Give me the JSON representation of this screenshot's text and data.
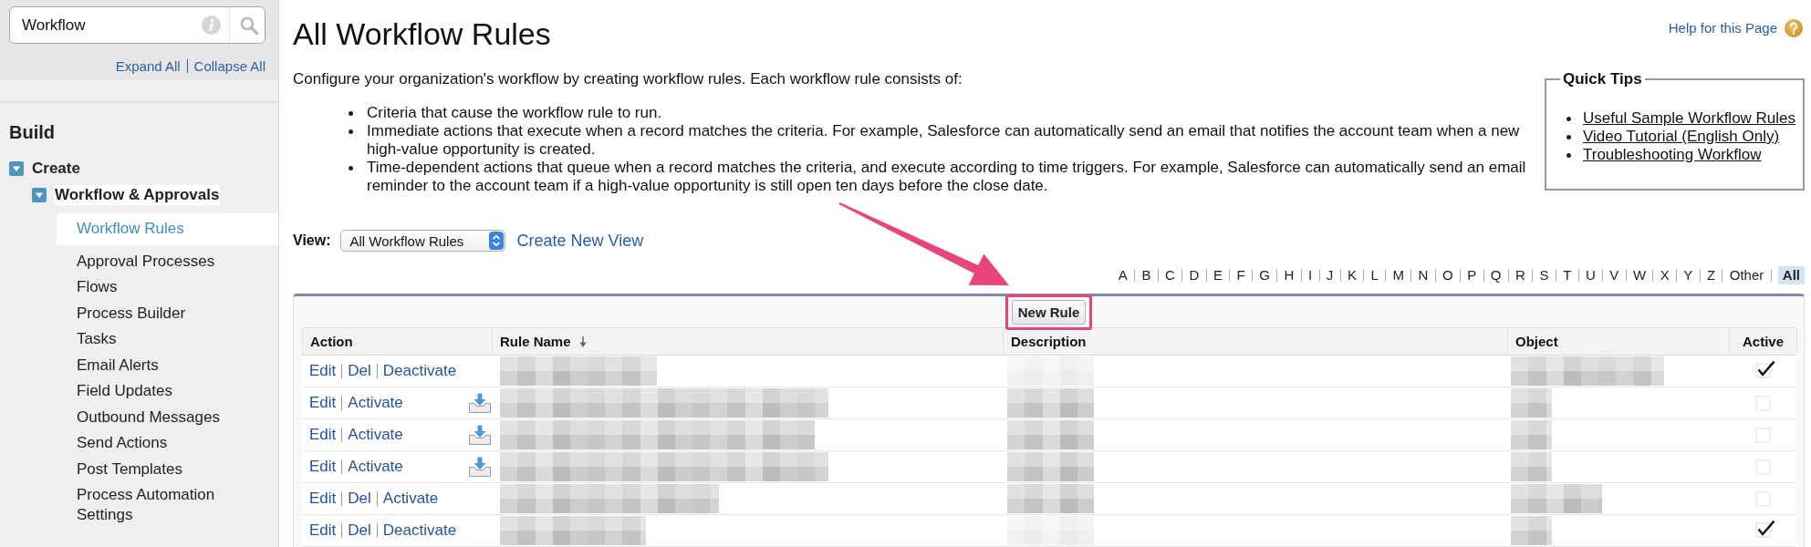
{
  "sidebar": {
    "search": {
      "value": "Workflow"
    },
    "links": [
      {
        "label": "Expand All"
      },
      {
        "label": "Collapse All"
      }
    ],
    "section_title": "Build",
    "tree": [
      {
        "label": "Create",
        "expanded": true,
        "selected": false,
        "highlighted": false,
        "children": [
          {
            "label": "Workflow & Approvals",
            "expanded": true,
            "selected": false,
            "highlighted": true,
            "children": [
              {
                "label": "Workflow Rules",
                "selected": true
              },
              {
                "label": "Approval Processes",
                "selected": false
              },
              {
                "label": "Flows",
                "selected": false
              },
              {
                "label": "Process Builder",
                "selected": false
              },
              {
                "label": "Tasks",
                "selected": false
              },
              {
                "label": "Email Alerts",
                "selected": false
              },
              {
                "label": "Field Updates",
                "selected": false
              },
              {
                "label": "Outbound Messages",
                "selected": false
              },
              {
                "label": "Send Actions",
                "selected": false
              },
              {
                "label": "Post Templates",
                "selected": false
              },
              {
                "label": "Process Automation Settings",
                "selected": false
              }
            ]
          }
        ]
      }
    ]
  },
  "header": {
    "title": "All Workflow Rules",
    "help_link": "Help for this Page"
  },
  "description": {
    "intro": "Configure your organization's workflow by creating workflow rules. Each workflow rule consists of:",
    "bullets": [
      "Criteria that cause the workflow rule to run.",
      "Immediate actions that execute when a record matches the criteria. For example, Salesforce can automatically send an email that notifies the account team when a new high-value opportunity is created.",
      "Time-dependent actions that queue when a record matches the criteria, and execute according to time triggers. For example, Salesforce can automatically send an email reminder to the account team if a high-value opportunity is still open ten days before the close date."
    ]
  },
  "quick_tips": {
    "title": "Quick Tips",
    "links": [
      "Useful Sample Workflow Rules",
      "Video Tutorial (English Only)",
      "Troubleshooting Workflow"
    ]
  },
  "view": {
    "label": "View:",
    "selected_view": "All Workflow Rules",
    "create_link": "Create New View"
  },
  "alphabet": [
    {
      "label": "A",
      "selected": false
    },
    {
      "label": "B",
      "selected": false
    },
    {
      "label": "C",
      "selected": false
    },
    {
      "label": "D",
      "selected": false
    },
    {
      "label": "E",
      "selected": false
    },
    {
      "label": "F",
      "selected": false
    },
    {
      "label": "G",
      "selected": false
    },
    {
      "label": "H",
      "selected": false
    },
    {
      "label": "I",
      "selected": false
    },
    {
      "label": "J",
      "selected": false
    },
    {
      "label": "K",
      "selected": false
    },
    {
      "label": "L",
      "selected": false
    },
    {
      "label": "M",
      "selected": false
    },
    {
      "label": "N",
      "selected": false
    },
    {
      "label": "O",
      "selected": false
    },
    {
      "label": "P",
      "selected": false
    },
    {
      "label": "Q",
      "selected": false
    },
    {
      "label": "R",
      "selected": false
    },
    {
      "label": "S",
      "selected": false
    },
    {
      "label": "T",
      "selected": false
    },
    {
      "label": "U",
      "selected": false
    },
    {
      "label": "V",
      "selected": false
    },
    {
      "label": "W",
      "selected": false
    },
    {
      "label": "X",
      "selected": false
    },
    {
      "label": "Y",
      "selected": false
    },
    {
      "label": "Z",
      "selected": false
    },
    {
      "label": "Other",
      "selected": false
    },
    {
      "label": "All",
      "selected": true
    }
  ],
  "rules_table": {
    "new_button": "New Rule",
    "columns": [
      {
        "label": "Action",
        "sorted": false
      },
      {
        "label": "Rule Name",
        "sorted": true
      },
      {
        "label": "Description",
        "sorted": false
      },
      {
        "label": "Object",
        "sorted": false
      },
      {
        "label": "Active",
        "sorted": false
      }
    ],
    "rows": [
      {
        "actions": [
          "Edit",
          "Del",
          "Deactivate"
        ],
        "row_icon": false,
        "active": true
      },
      {
        "actions": [
          "Edit",
          "Activate"
        ],
        "row_icon": true,
        "active": false
      },
      {
        "actions": [
          "Edit",
          "Activate"
        ],
        "row_icon": true,
        "active": false
      },
      {
        "actions": [
          "Edit",
          "Activate"
        ],
        "row_icon": true,
        "active": false
      },
      {
        "actions": [
          "Edit",
          "Del",
          "Activate"
        ],
        "row_icon": false,
        "active": false
      },
      {
        "actions": [
          "Edit",
          "Del",
          "Deactivate"
        ],
        "row_icon": false,
        "active": true
      }
    ]
  }
}
